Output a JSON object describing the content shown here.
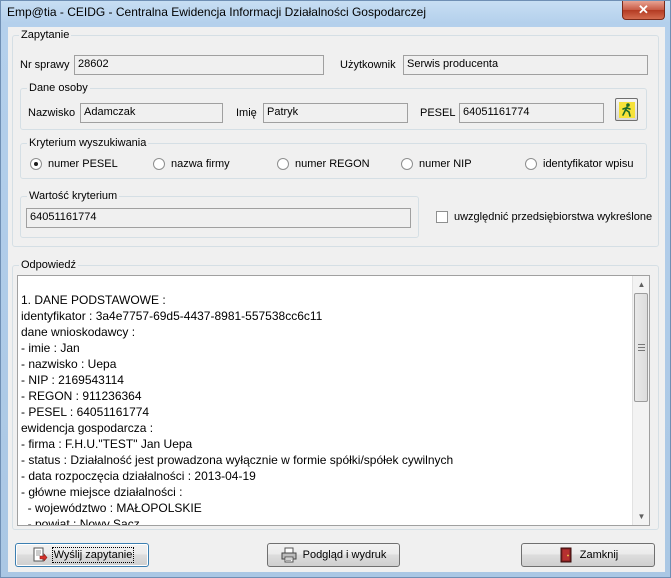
{
  "window": {
    "title": "Emp@tia - CEIDG - Centralna Ewidencja Informacji Działalności Gospodarczej",
    "close_glyph": "✕"
  },
  "zapytanie": {
    "legend": "Zapytanie",
    "nr_sprawy_label": "Nr sprawy",
    "nr_sprawy_value": "28602",
    "uzytkownik_label": "Użytkownik",
    "uzytkownik_value": "Serwis producenta"
  },
  "dane_osoby": {
    "legend": "Dane osoby",
    "nazwisko_label": "Nazwisko",
    "nazwisko_value": "Adamczak",
    "imie_label": "Imię",
    "imie_value": "Patryk",
    "pesel_label": "PESEL",
    "pesel_value": "64051161774"
  },
  "kryterium": {
    "legend": "Kryterium wyszukiwania",
    "options": [
      {
        "label": "numer PESEL",
        "selected": true
      },
      {
        "label": "nazwa firmy",
        "selected": false
      },
      {
        "label": "numer REGON",
        "selected": false
      },
      {
        "label": "numer NIP",
        "selected": false
      },
      {
        "label": "identyfikator wpisu",
        "selected": false
      }
    ]
  },
  "wartosc": {
    "legend": "Wartość kryterium",
    "value": "64051161774"
  },
  "wykreslone": {
    "label": "uwzględnić przedsiębiorstwa wykreślone",
    "checked": false
  },
  "odpowiedz": {
    "legend": "Odpowiedź",
    "lines": [
      "1. DANE PODSTAWOWE :",
      "identyfikator : 3a4e7757-69d5-4437-8981-557538cc6c11",
      "dane wnioskodawcy :",
      "- imie : Jan",
      "- nazwisko : Uepa",
      "- NIP : 2169543114",
      "- REGON : 911236364",
      "- PESEL : 64051161774",
      "ewidencja gospodarcza :",
      "- firma : F.H.U.\"TEST\" Jan Uepa",
      "- status : Działalność jest prowadzona wyłącznie w formie spółki/spółek cywilnych",
      "- data rozpoczęcia działalności : 2013-04-19",
      "- główne miejsce działalności :",
      "  - województwo : MAŁOPOLSKIE",
      "  - powiat : Nowy Sącz"
    ]
  },
  "buttons": {
    "send": "Wyślij zapytanie",
    "preview": "Podgląd i wydruk",
    "close": "Zamknij"
  },
  "icons": {
    "send": "send-document-icon",
    "preview": "printer-icon",
    "close": "exit-door-icon",
    "person": "running-person-icon"
  }
}
